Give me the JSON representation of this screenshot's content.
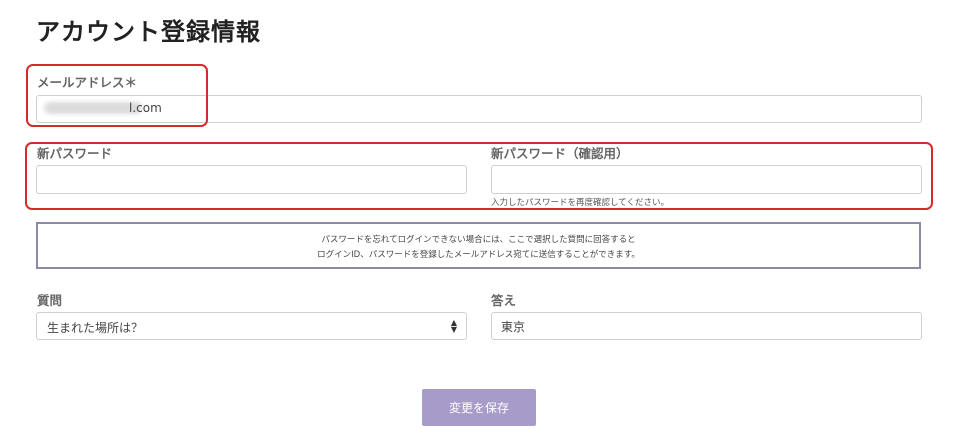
{
  "page": {
    "title": "アカウント登録情報"
  },
  "email": {
    "label": "メールアドレス＊",
    "value_visible_suffix": "l.com"
  },
  "new_password": {
    "label": "新パスワード",
    "value": ""
  },
  "confirm_password": {
    "label": "新パスワード（確認用）",
    "value": "",
    "hint": "入力したパスワードを再度確認してください。"
  },
  "notice": {
    "line1": "パスワードを忘れてログインできない場合には、ここで選択した質問に回答すると",
    "line2": "ログインID、パスワードを登録したメールアドレス宛てに送信することができます。"
  },
  "question": {
    "label": "質問",
    "selected": "生まれた場所は？"
  },
  "answer": {
    "label": "答え",
    "value": "東京"
  },
  "actions": {
    "save_label": "変更を保存"
  },
  "colors": {
    "highlight_red": "#d72a2a",
    "button_purple": "#a79bc9",
    "notice_border": "#8d8aa5"
  },
  "icons": {
    "select_arrow": "sort-arrows-icon"
  }
}
